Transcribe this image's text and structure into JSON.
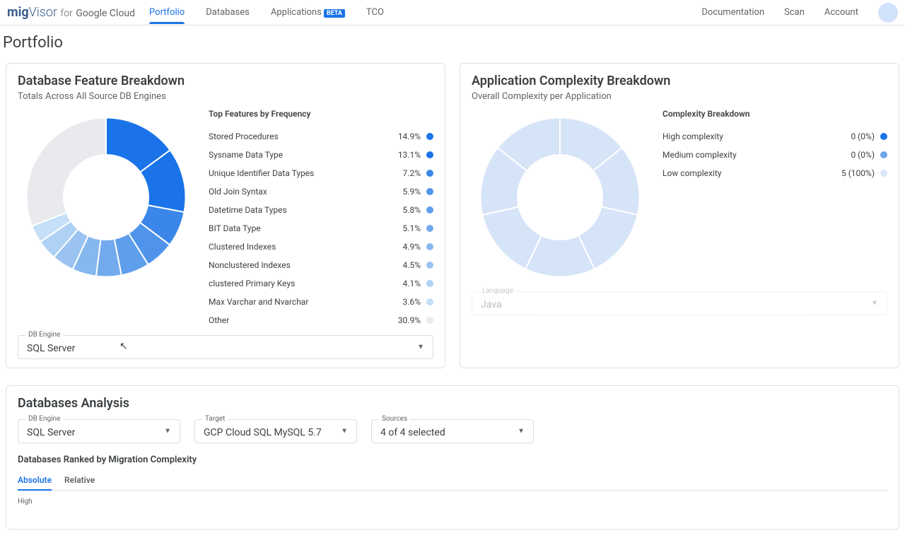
{
  "brand": {
    "mig": "mig",
    "visor": "Visor",
    "for": "for",
    "google": "Google Cloud"
  },
  "nav": {
    "items": [
      "Portfolio",
      "Databases",
      "Applications",
      "TCO"
    ],
    "beta": "BETA",
    "right": [
      "Documentation",
      "Scan",
      "Account"
    ]
  },
  "page_title": "Portfolio",
  "feature_card": {
    "title": "Database Feature Breakdown",
    "subtitle": "Totals Across All Source DB Engines",
    "legend_title": "Top Features by Frequency",
    "rows": [
      {
        "label": "Stored Procedures",
        "pct": "14.9%",
        "color": "#1a73e8"
      },
      {
        "label": "Sysname Data Type",
        "pct": "13.1%",
        "color": "#1a73e8"
      },
      {
        "label": "Unique Identifier Data Types",
        "pct": "7.2%",
        "color": "#3b87e9"
      },
      {
        "label": "Old Join Syntax",
        "pct": "5.9%",
        "color": "#4f94ea"
      },
      {
        "label": "Datetime Data Types",
        "pct": "5.8%",
        "color": "#5f9eeb"
      },
      {
        "label": "BIT Data Type",
        "pct": "5.1%",
        "color": "#72aaed"
      },
      {
        "label": "Clustered Indexes",
        "pct": "4.9%",
        "color": "#86b7ef"
      },
      {
        "label": "Nonclustered Indexes",
        "pct": "4.5%",
        "color": "#9ac3f1"
      },
      {
        "label": "clustered Primary Keys",
        "pct": "4.1%",
        "color": "#afd1f4"
      },
      {
        "label": "Max Varchar and Nvarchar",
        "pct": "3.6%",
        "color": "#c4dff7"
      },
      {
        "label": "Other",
        "pct": "30.9%",
        "color": "#e8eaed"
      }
    ],
    "select_label": "DB Engine",
    "select_value": "SQL Server"
  },
  "complexity_card": {
    "title": "Application Complexity Breakdown",
    "subtitle": "Overall Complexity per Application",
    "legend_title": "Complexity Breakdown",
    "rows": [
      {
        "label": "High complexity",
        "pct": "0 (0%)",
        "color": "#1a73e8"
      },
      {
        "label": "Medium complexity",
        "pct": "0 (0%)",
        "color": "#6ea6ec"
      },
      {
        "label": "Low complexity",
        "pct": "5 (100%)",
        "color": "#dbe7f7"
      }
    ],
    "select_label": "Language",
    "select_value": "Java"
  },
  "analysis": {
    "title": "Databases Analysis",
    "filters": [
      {
        "label": "DB Engine",
        "value": "SQL Server"
      },
      {
        "label": "Target",
        "value": "GCP Cloud SQL MySQL 5.7"
      },
      {
        "label": "Sources",
        "value": "4 of 4 selected"
      }
    ],
    "ranked_title": "Databases Ranked by Migration Complexity",
    "tabs": [
      "Absolute",
      "Relative"
    ],
    "y_label": "High"
  },
  "chart_data": [
    {
      "type": "pie",
      "title": "Database Feature Breakdown",
      "series": [
        {
          "name": "Features",
          "values": [
            14.9,
            13.1,
            7.2,
            5.9,
            5.8,
            5.1,
            4.9,
            4.5,
            4.1,
            3.6,
            30.9
          ]
        }
      ],
      "categories": [
        "Stored Procedures",
        "Sysname Data Type",
        "Unique Identifier Data Types",
        "Old Join Syntax",
        "Datetime Data Types",
        "BIT Data Type",
        "Clustered Indexes",
        "Nonclustered Indexes",
        "clustered Primary Keys",
        "Max Varchar and Nvarchar",
        "Other"
      ]
    },
    {
      "type": "pie",
      "title": "Application Complexity Breakdown",
      "series": [
        {
          "name": "Complexity",
          "values": [
            0,
            0,
            100
          ]
        }
      ],
      "categories": [
        "High complexity",
        "Medium complexity",
        "Low complexity"
      ]
    }
  ]
}
